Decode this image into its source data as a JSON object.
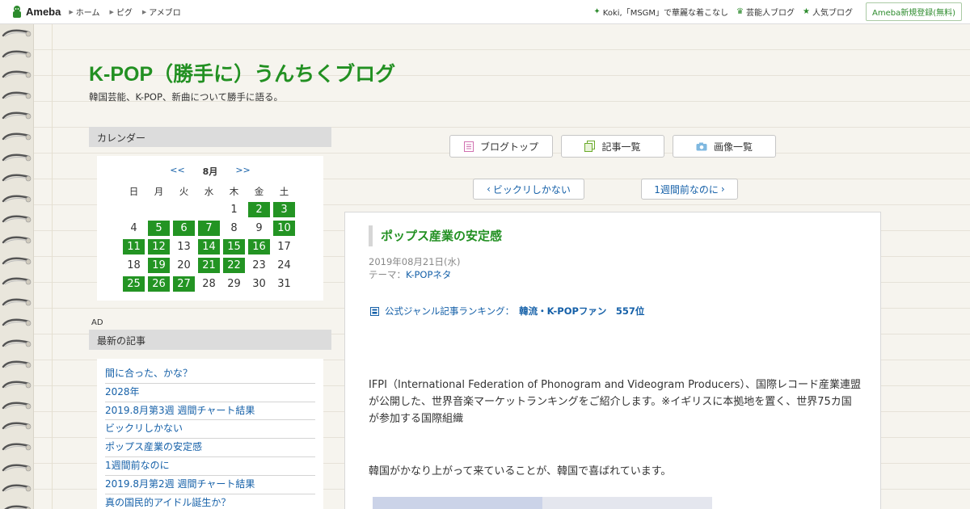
{
  "topbar": {
    "logo_text": "Ameba",
    "nav": [
      "ホーム",
      "ピグ",
      "アメブロ"
    ],
    "promo": "Koki,「MSGM」で華麗な着こなし",
    "celeb_blog": "芸能人ブログ",
    "popular_blog": "人気ブログ",
    "signup": "Ameba新規登録(無料)"
  },
  "blog": {
    "title": "K-POP（勝手に）うんちくブログ",
    "description": "韓国芸能、K-POP、新曲について勝手に語る。"
  },
  "sidebar": {
    "calendar_heading": "カレンダー",
    "calendar": {
      "prev": "<<",
      "month": "8月",
      "next": ">>",
      "weekdays": [
        "日",
        "月",
        "火",
        "水",
        "木",
        "金",
        "土"
      ],
      "weeks": [
        [
          {
            "d": ""
          },
          {
            "d": ""
          },
          {
            "d": ""
          },
          {
            "d": ""
          },
          {
            "d": "1"
          },
          {
            "d": "2",
            "link": true
          },
          {
            "d": "3",
            "link": true
          }
        ],
        [
          {
            "d": "4"
          },
          {
            "d": "5",
            "link": true
          },
          {
            "d": "6",
            "link": true
          },
          {
            "d": "7",
            "link": true
          },
          {
            "d": "8"
          },
          {
            "d": "9"
          },
          {
            "d": "10",
            "link": true
          }
        ],
        [
          {
            "d": "11",
            "link": true
          },
          {
            "d": "12",
            "link": true
          },
          {
            "d": "13"
          },
          {
            "d": "14",
            "link": true
          },
          {
            "d": "15",
            "link": true
          },
          {
            "d": "16",
            "link": true
          },
          {
            "d": "17"
          }
        ],
        [
          {
            "d": "18"
          },
          {
            "d": "19",
            "link": true
          },
          {
            "d": "20"
          },
          {
            "d": "21",
            "link": true
          },
          {
            "d": "22",
            "link": true
          },
          {
            "d": "23"
          },
          {
            "d": "24"
          }
        ],
        [
          {
            "d": "25",
            "link": true
          },
          {
            "d": "26",
            "link": true
          },
          {
            "d": "27",
            "link": true
          },
          {
            "d": "28"
          },
          {
            "d": "29"
          },
          {
            "d": "30"
          },
          {
            "d": "31"
          }
        ]
      ]
    },
    "ad_label": "AD",
    "recent_heading": "最新の記事",
    "recent": [
      "間に合った、かな？",
      "2028年",
      "2019.8月第3週 週間チャート結果",
      "ビックリしかない",
      "ポップス産業の安定感",
      "1週間前なのに",
      "2019.8月第2週 週間チャート結果",
      "真の国民的アイドル誕生か？"
    ]
  },
  "nav_buttons": {
    "blog_top": "ブログトップ",
    "article_list": "記事一覧",
    "image_list": "画像一覧"
  },
  "pager": {
    "prev": "ビックリしかない",
    "next": "1週間前なのに"
  },
  "article": {
    "title": "ポップス産業の安定感",
    "date": "2019年08月21日(水)",
    "theme_label": "テーマ：",
    "theme": "K-POPネタ",
    "ranking_label": "公式ジャンル記事ランキング：",
    "ranking_value": "韓流・K-POPファン　557位",
    "paragraph1": "IFPI（International Federation of Phonogram and Videogram Producers）、国際レコード産業連盟が公開した、世界音楽マーケットランキングをご紹介します。※イギリスに本拠地を置く、世界75カ国が参加する国際組織",
    "paragraph2": "韓国がかなり上がって来ていることが、韓国で喜ばれています。"
  },
  "colors": {
    "accent_green": "#229022",
    "link_blue": "#1560a8",
    "calendar_link_bg": "#239423"
  }
}
